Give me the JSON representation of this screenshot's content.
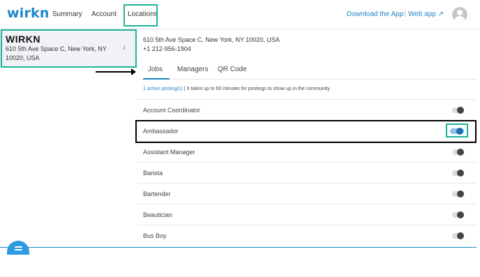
{
  "header": {
    "logo": "wirkn",
    "nav": [
      "Summary",
      "Account",
      "Locations"
    ],
    "download_app": "Download the App",
    "separator": "|",
    "web_app": "Web app ↗"
  },
  "location_card": {
    "name": "WIRKN",
    "address": "610 5th Ave Space C, New York, NY 10020, USA",
    "chevron": "›"
  },
  "main": {
    "address": "610 5th Ave Space C, New York, NY 10020, USA",
    "phone": "+1 212-956-1904",
    "tabs": [
      "Jobs",
      "Managers",
      "QR Code"
    ],
    "active_tab": "Jobs",
    "notice_link": "1 active posting(s)",
    "notice_text": " | It takes up to 60 minutes for postings to show up in the community."
  },
  "jobs": [
    {
      "label": "Account Coordinator",
      "enabled": false
    },
    {
      "label": "Ambassador",
      "enabled": true
    },
    {
      "label": "Assistant Manager",
      "enabled": false
    },
    {
      "label": "Barista",
      "enabled": false
    },
    {
      "label": "Bartender",
      "enabled": false
    },
    {
      "label": "Beautician",
      "enabled": false
    },
    {
      "label": "Bus Boy",
      "enabled": false
    }
  ],
  "colors": {
    "brand": "#1e86c8",
    "annotation": "#1fb39c"
  },
  "icons": {
    "avatar": "user-avatar-icon",
    "chat": "chat-bubble-icon",
    "chevron": "chevron-right-icon"
  }
}
